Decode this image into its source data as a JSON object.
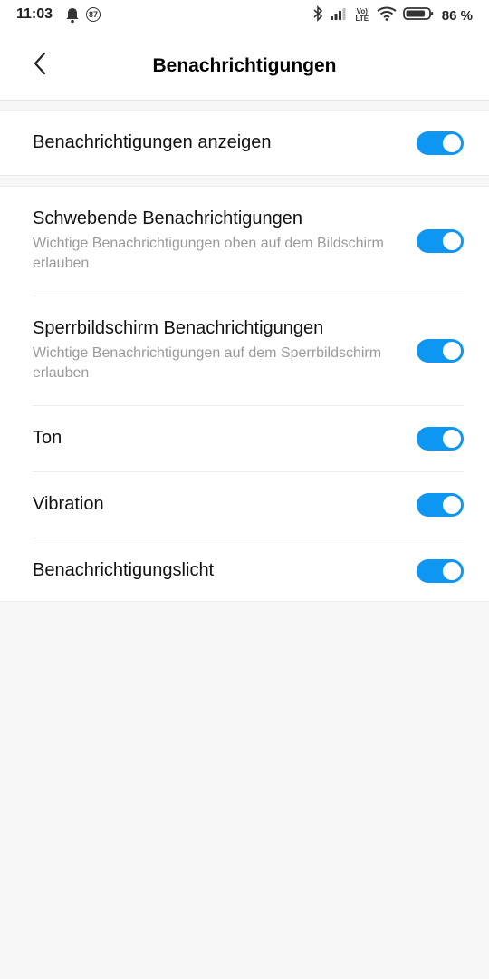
{
  "status_bar": {
    "time": "11:03",
    "notification_count": "87",
    "network_label": "Vo) LTE",
    "battery_percent": "86 %",
    "battery_level": 0.86,
    "icons": [
      "bell-icon",
      "bluetooth-icon",
      "signal-icon",
      "wifi-icon",
      "battery-icon"
    ]
  },
  "header": {
    "title": "Benachrichtigungen",
    "back_icon": "chevron-left-icon"
  },
  "accent_color": "#0d96f2",
  "sections": {
    "main": {
      "title": "Benachrichtigungen anzeigen",
      "enabled": true
    },
    "settings": [
      {
        "title": "Schwebende Benachrichtigungen",
        "subtitle": "Wichtige Benachrichtigungen oben auf dem Bildschirm erlauben",
        "enabled": true
      },
      {
        "title": "Sperrbildschirm Benachrichtigungen",
        "subtitle": "Wichtige Benachrichtigungen auf dem Sperrbildschirm erlauben",
        "enabled": true
      },
      {
        "title": "Ton",
        "enabled": true
      },
      {
        "title": "Vibration",
        "enabled": true
      },
      {
        "title": "Benachrichtigungslicht",
        "enabled": true
      }
    ]
  }
}
